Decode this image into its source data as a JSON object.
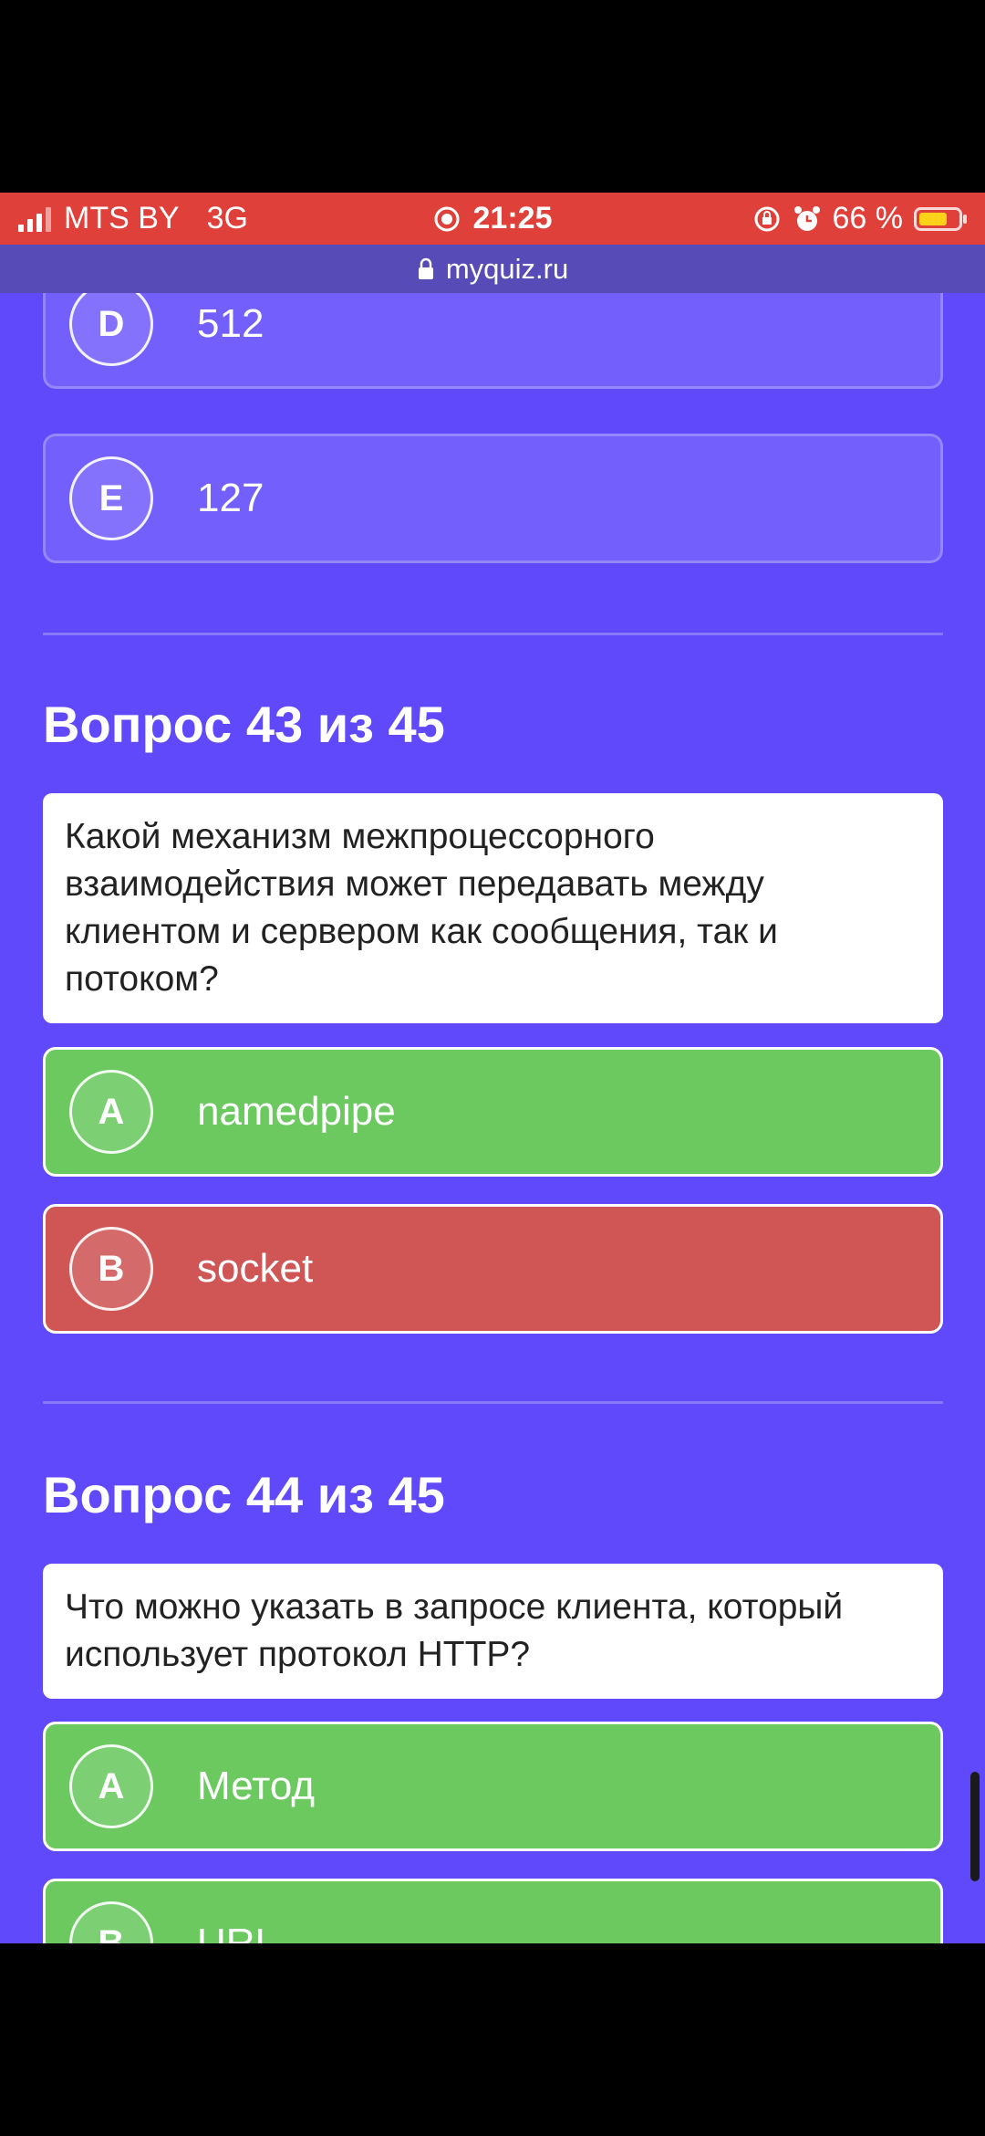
{
  "status_bar": {
    "carrier": "MTS BY",
    "network": "3G",
    "time": "21:25",
    "battery": "66 %"
  },
  "browser": {
    "url": "myquiz.ru"
  },
  "prev_options": [
    {
      "letter": "D",
      "text": "512"
    },
    {
      "letter": "E",
      "text": "127"
    }
  ],
  "q43": {
    "heading": "Вопрос 43 из 45",
    "text": "Какой механизм межпроцессорного взаимодействия может передавать между клиентом и сервером как сообщения, так и потоком?",
    "options": [
      {
        "letter": "A",
        "text": "namedpipe",
        "state": "correct"
      },
      {
        "letter": "B",
        "text": "socket",
        "state": "wrong"
      }
    ]
  },
  "q44": {
    "heading": "Вопрос 44 из 45",
    "text": "Что можно указать в запросе клиента, который использует протокол HTTP?",
    "options": [
      {
        "letter": "A",
        "text": "Метод",
        "state": "correct"
      },
      {
        "letter": "B",
        "text": "URL",
        "state": "correct"
      }
    ]
  },
  "colors": {
    "background": "#6049fb",
    "correct": "#6bc960",
    "wrong": "#d05656",
    "status_bar": "#e0403a"
  }
}
